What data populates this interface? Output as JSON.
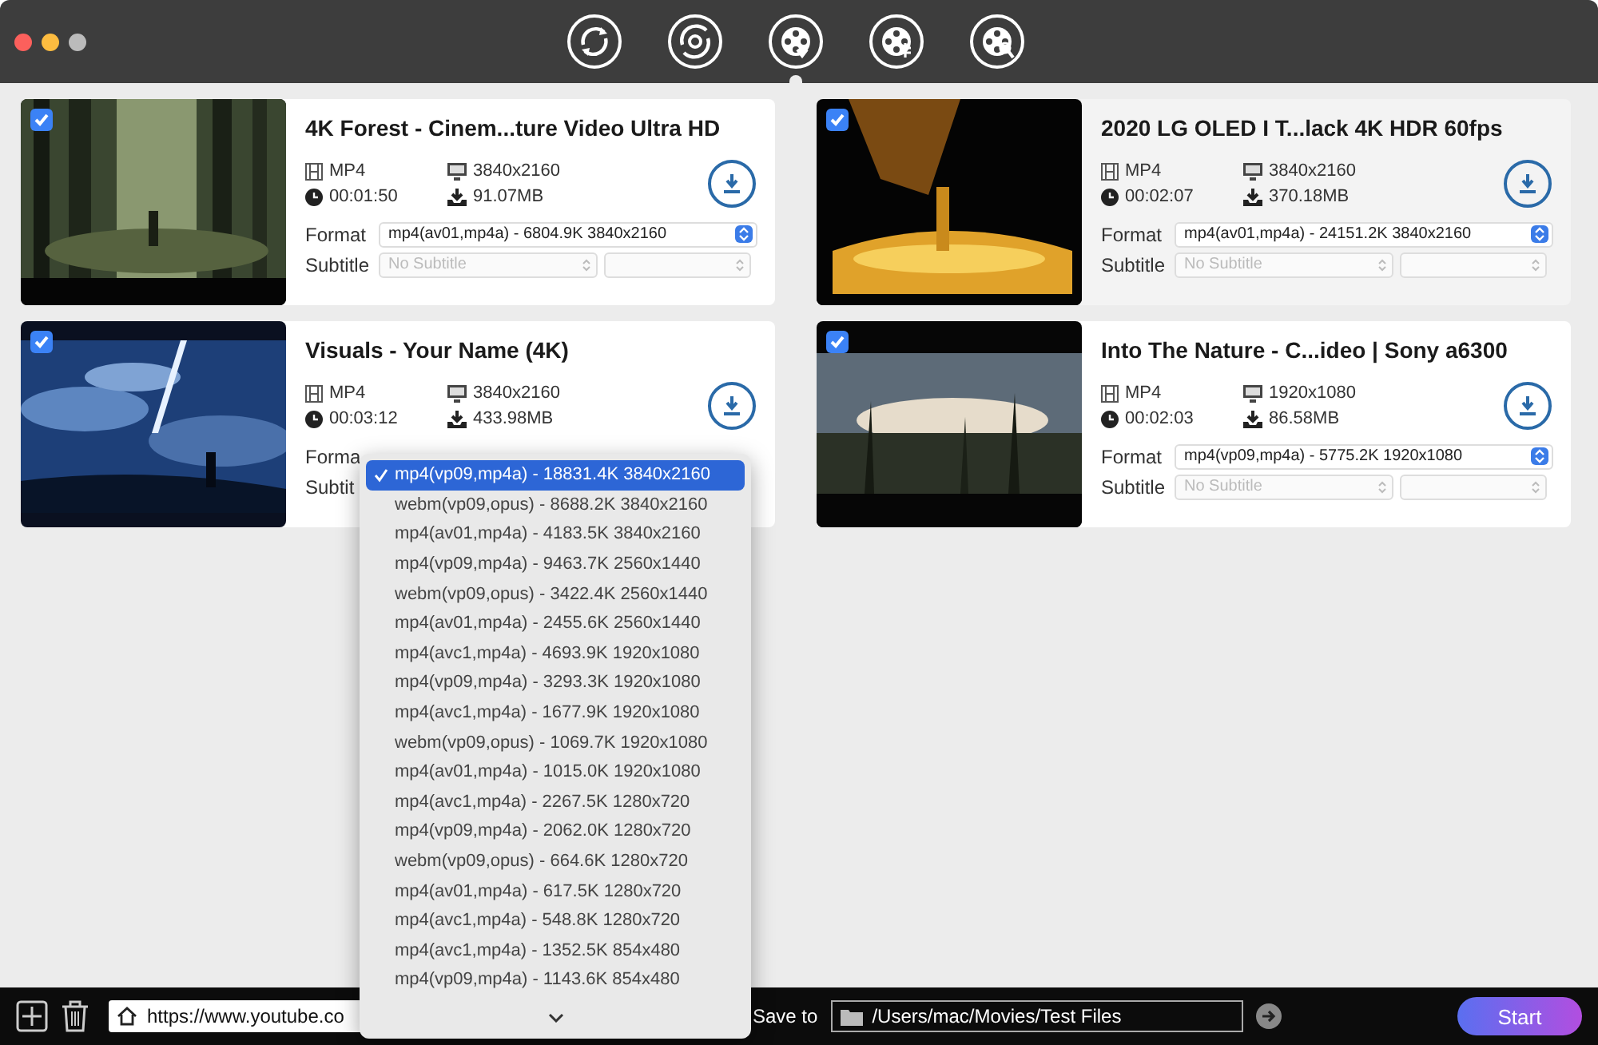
{
  "toolbar": [
    {
      "kind": "sync",
      "selected": false
    },
    {
      "kind": "sync-dot",
      "selected": false
    },
    {
      "kind": "reel-down",
      "selected": true
    },
    {
      "kind": "reel-convert",
      "selected": false
    },
    {
      "kind": "reel-search",
      "selected": false
    }
  ],
  "videos": [
    {
      "title": "4K Forest - Cinem...ture Video Ultra HD",
      "container": "MP4",
      "resolution": "3840x2160",
      "duration": "00:01:50",
      "size": "91.07MB",
      "checked": true,
      "selected": false,
      "format_label": "Format",
      "format_value": "mp4(av01,mp4a) - 6804.9K 3840x2160",
      "subtitle_label": "Subtitle",
      "subtitle_placeholder": "No Subtitle"
    },
    {
      "title": "2020 LG OLED I  T...lack 4K HDR 60fps",
      "container": "MP4",
      "resolution": "3840x2160",
      "duration": "00:02:07",
      "size": "370.18MB",
      "checked": true,
      "selected": true,
      "format_label": "Format",
      "format_value": "mp4(av01,mp4a) - 24151.2K 3840x2160",
      "subtitle_label": "Subtitle",
      "subtitle_placeholder": "No Subtitle"
    },
    {
      "title": "Visuals - Your Name (4K)",
      "container": "MP4",
      "resolution": "3840x2160",
      "duration": "00:03:12",
      "size": "433.98MB",
      "checked": true,
      "selected": false,
      "format_label": "Forma",
      "subtitle_label": "Subtit"
    },
    {
      "title": "Into The Nature - C...ideo | Sony a6300",
      "container": "MP4",
      "resolution": "1920x1080",
      "duration": "00:02:03",
      "size": "86.58MB",
      "checked": true,
      "selected": false,
      "format_label": "Format",
      "format_value": "mp4(vp09,mp4a) - 5775.2K 1920x1080",
      "subtitle_label": "Subtitle",
      "subtitle_placeholder": "No Subtitle"
    }
  ],
  "format_menu": {
    "options": [
      {
        "label": "mp4(vp09,mp4a) - 18831.4K 3840x2160",
        "selected": true
      },
      {
        "label": "webm(vp09,opus) - 8688.2K 3840x2160",
        "selected": false
      },
      {
        "label": "mp4(av01,mp4a) - 4183.5K 3840x2160",
        "selected": false
      },
      {
        "label": "mp4(vp09,mp4a) - 9463.7K 2560x1440",
        "selected": false
      },
      {
        "label": "webm(vp09,opus) - 3422.4K 2560x1440",
        "selected": false
      },
      {
        "label": "mp4(av01,mp4a) - 2455.6K 2560x1440",
        "selected": false
      },
      {
        "label": "mp4(avc1,mp4a) - 4693.9K 1920x1080",
        "selected": false
      },
      {
        "label": "mp4(vp09,mp4a) - 3293.3K 1920x1080",
        "selected": false
      },
      {
        "label": "mp4(avc1,mp4a) - 1677.9K 1920x1080",
        "selected": false
      },
      {
        "label": "webm(vp09,opus) - 1069.7K 1920x1080",
        "selected": false
      },
      {
        "label": "mp4(av01,mp4a) - 1015.0K 1920x1080",
        "selected": false
      },
      {
        "label": "mp4(avc1,mp4a) - 2267.5K 1280x720",
        "selected": false
      },
      {
        "label": "mp4(vp09,mp4a) - 2062.0K 1280x720",
        "selected": false
      },
      {
        "label": "webm(vp09,opus) - 664.6K 1280x720",
        "selected": false
      },
      {
        "label": "mp4(av01,mp4a) - 617.5K 1280x720",
        "selected": false
      },
      {
        "label": "mp4(avc1,mp4a) - 548.8K 1280x720",
        "selected": false
      },
      {
        "label": "mp4(avc1,mp4a) - 1352.5K 854x480",
        "selected": false
      },
      {
        "label": "mp4(vp09,mp4a) - 1143.6K 854x480",
        "selected": false
      }
    ]
  },
  "bottom_bar": {
    "url": "https://www.youtube.co",
    "save_to_label": "Save to",
    "save_path": "/Users/mac/Movies/Test Files",
    "start_label": "Start"
  }
}
